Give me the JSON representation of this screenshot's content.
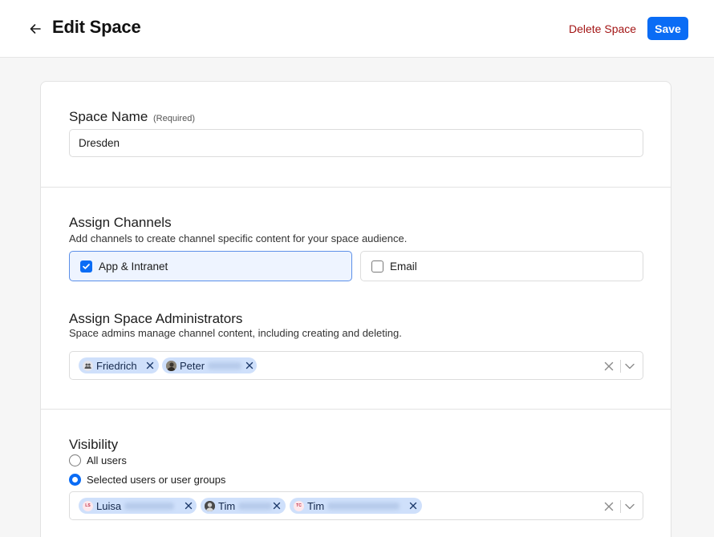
{
  "header": {
    "title": "Edit Space",
    "delete_label": "Delete Space",
    "save_label": "Save"
  },
  "space_name": {
    "label": "Space Name",
    "required_tag": "(Required)",
    "value": "Dresden"
  },
  "channels": {
    "title": "Assign Channels",
    "description": "Add channels to create channel specific content for your space audience.",
    "options": [
      {
        "label": "App & Intranet",
        "checked": true
      },
      {
        "label": "Email",
        "checked": false
      }
    ]
  },
  "admins": {
    "title": "Assign Space Administrators",
    "description": "Space admins manage channel content, including creating and deleting.",
    "chips": [
      {
        "name": "Friedrich",
        "avatar": "group-icon"
      },
      {
        "name": "Peter",
        "avatar": "photo-avatar"
      }
    ]
  },
  "visibility": {
    "title": "Visibility",
    "options": [
      {
        "label": "All users",
        "selected": false
      },
      {
        "label": "Selected users or user groups",
        "selected": true
      }
    ],
    "chips": [
      {
        "name": "Luisa",
        "initials": "LS",
        "avatar": "initials-avatar"
      },
      {
        "name": "Tim",
        "avatar": "photo-avatar"
      },
      {
        "name": "Tim",
        "initials": "TC",
        "avatar": "initials-avatar"
      }
    ]
  },
  "colors": {
    "accent": "#0a6cf5",
    "danger": "#a31515",
    "chip": "#cfe0fb",
    "selected_bg": "#eef4ff"
  }
}
